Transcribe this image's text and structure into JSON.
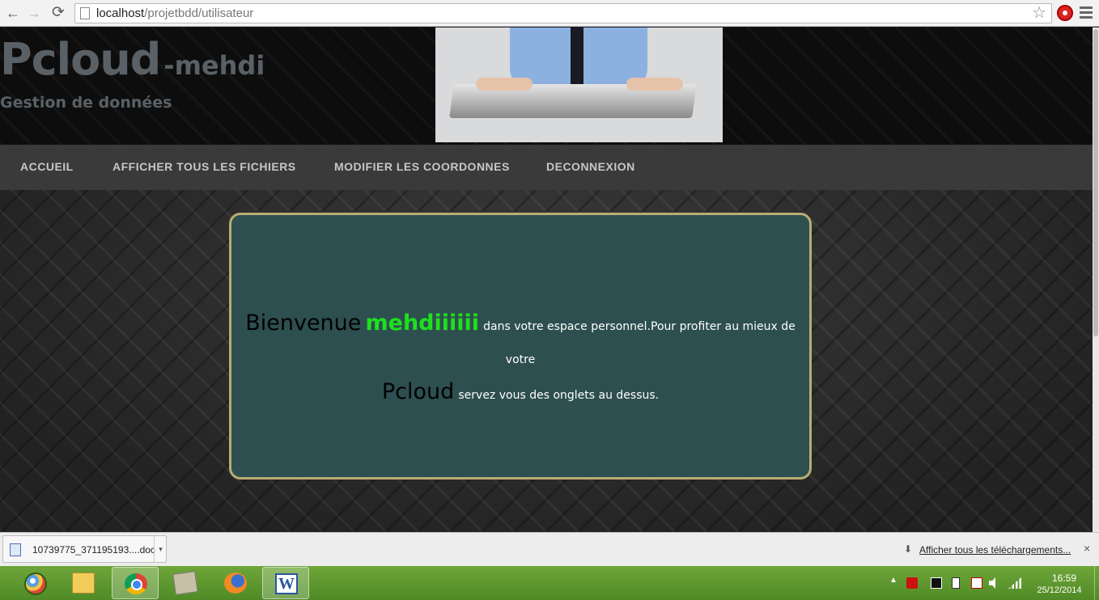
{
  "browser": {
    "url_host": "localhost",
    "url_path": "/projetbdd/utilisateur",
    "nav_back": "←",
    "nav_forward": "→",
    "nav_reload": "⟳",
    "bookmark_star": "☆"
  },
  "site": {
    "title": "Pcloud",
    "title_suffix": "-mehdi",
    "subtitle": "Gestion de données",
    "menu": [
      {
        "label": "ACCUEIL"
      },
      {
        "label": "AFFICHER TOUS LES FICHIERS"
      },
      {
        "label": "MODIFIER LES COORDONNES"
      },
      {
        "label": "DECONNEXION"
      }
    ]
  },
  "welcome": {
    "greeting": "Bienvenue",
    "username": "mehdiiiiii",
    "text_1": "dans votre espace personnel.Pour profiter au mieux de votre",
    "brand": "Pcloud",
    "text_2": "servez vous des onglets au dessus."
  },
  "downloads": {
    "file_name": "10739775_371195193....doc",
    "caret": "▾",
    "show_all": "Afficher tous les téléchargements...",
    "close": "×",
    "arrow": "⬇"
  },
  "taskbar": {
    "tray_up": "▲",
    "time": "16:59",
    "date": "25/12/2014",
    "word_letter": "W"
  },
  "colors": {
    "welcome_box_bg": "#2e4f4f",
    "welcome_box_border": "#b8ad72",
    "username_color": "#1ee01e",
    "taskbar_green": "#5d9830"
  }
}
